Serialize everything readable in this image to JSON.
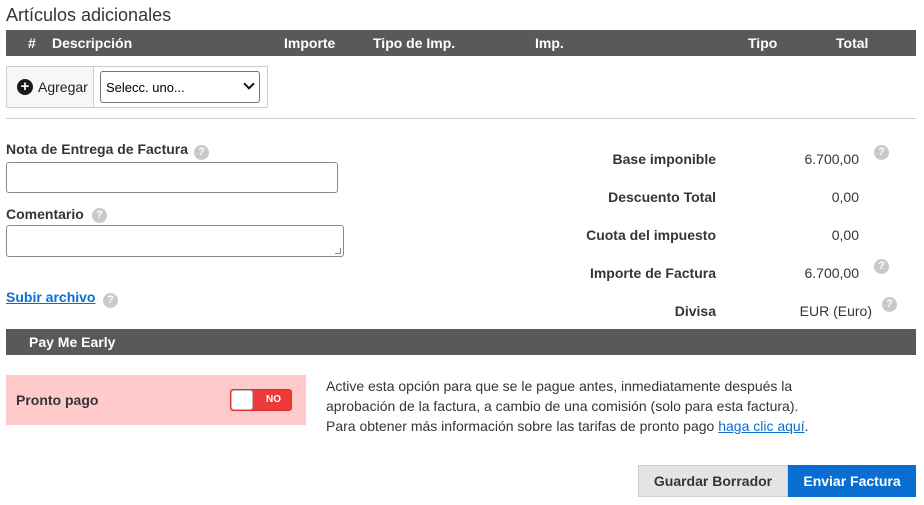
{
  "section": {
    "title": "Artículos adicionales"
  },
  "table": {
    "columns": [
      "#",
      "Descripción",
      "Importe",
      "Tipo de Imp.",
      "Imp.",
      "Tipo",
      "Total"
    ]
  },
  "add_row": {
    "add_label": "Agregar",
    "select_value": "Selecc. uno..."
  },
  "form": {
    "nota_label": "Nota de Entrega de Factura",
    "nota_value": "",
    "comentario_label": "Comentario",
    "comentario_value": "",
    "subir_label": "Subir archivo"
  },
  "summary": [
    {
      "label": "Base imponible",
      "value": "6.700,00",
      "help": true
    },
    {
      "label": "Descuento Total",
      "value": "0,00",
      "help": false
    },
    {
      "label": "Cuota del impuesto",
      "value": "0,00",
      "help": false
    },
    {
      "label": "Importe de Factura",
      "value": "6.700,00",
      "help": true
    },
    {
      "label": "Divisa",
      "value": "EUR (Euro)",
      "help": true
    }
  ],
  "pay_early": {
    "bar_title": "Pay Me Early",
    "pronto_label": "Pronto pago",
    "toggle_label": "NO",
    "info_line1": "Active esta opción para que se le pague antes, inmediatamente después la",
    "info_line2": "aprobación de la factura, a cambio de una comisión (solo para esta factura).",
    "info_line3_prefix": "Para obtener más información sobre las tarifas de pronto pago ",
    "info_link": "haga clic aquí",
    "info_line3_suffix": "."
  },
  "actions": {
    "draft_label": "Guardar Borrador",
    "send_label": "Enviar Factura"
  },
  "colors": {
    "header_bg": "#595959",
    "primary": "#0a6ed1",
    "toggle_off": "#ee3939",
    "pronto_bg": "#ffcaca"
  }
}
